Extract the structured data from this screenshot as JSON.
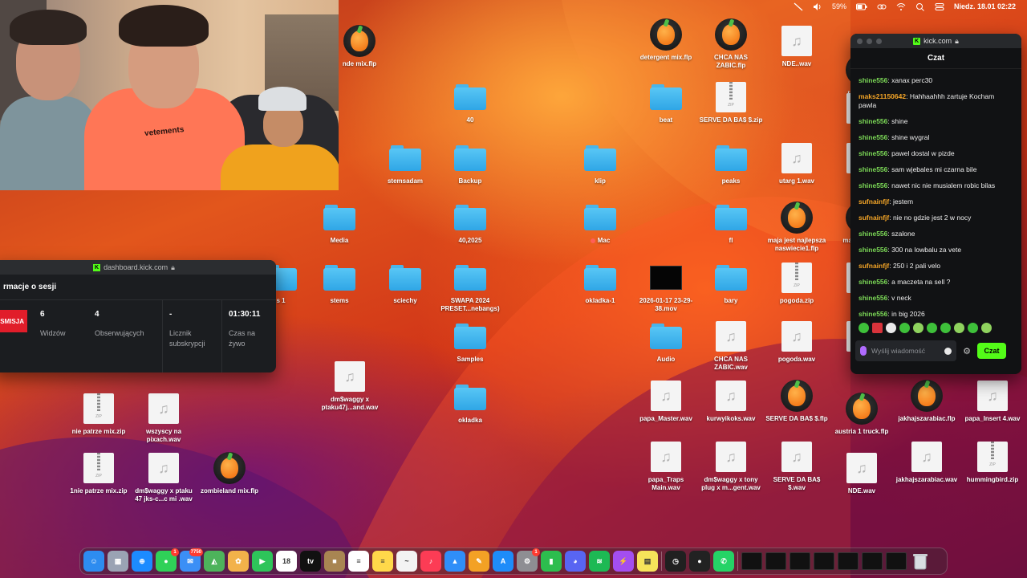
{
  "menubar": {
    "battery": "59%",
    "datetime": "Niedz. 18.01  02:22",
    "icons": [
      "mute-icon",
      "volume-icon",
      "battery-icon",
      "link-icon",
      "wifi-icon",
      "search-icon",
      "control-center-icon"
    ]
  },
  "dashboard": {
    "url": "dashboard.kick.com",
    "heading": "rmacje o sesji",
    "badge": "SMISJA",
    "stats": [
      {
        "value": "6",
        "label": "Widzów"
      },
      {
        "value": "4",
        "label": "Obserwujących"
      },
      {
        "value": "-",
        "label": "Licznik subskrypcji"
      },
      {
        "value": "01:30:11",
        "label": "Czas na żywo"
      }
    ]
  },
  "chat": {
    "url": "kick.com",
    "header": "Czat",
    "placeholder": "Wyślij wiadomość",
    "send_label": "Czat",
    "colors": {
      "green": "#53fc18",
      "user_green": "#7cd957",
      "user_orange": "#f4a527"
    },
    "messages": [
      {
        "user": "shine556",
        "text": "xanax perc30",
        "color": "#7cd957"
      },
      {
        "user": "maks21150642",
        "text": "Hahhaahhh zartuje Kocham pawla",
        "color": "#f4a527"
      },
      {
        "user": "shine556",
        "text": "shine",
        "color": "#7cd957"
      },
      {
        "user": "shine556",
        "text": "shine wygral",
        "color": "#7cd957"
      },
      {
        "user": "shine556",
        "text": "pawel dostal w pizde",
        "color": "#7cd957"
      },
      {
        "user": "shine556",
        "text": "sam wjebales mi czarna bile",
        "color": "#7cd957"
      },
      {
        "user": "shine556",
        "text": "nawet nic nie musialem robic bilas",
        "color": "#7cd957"
      },
      {
        "user": "sufnainfjf",
        "text": "jestem",
        "color": "#f4a527"
      },
      {
        "user": "sufnainfjf",
        "text": "nie no gdzie jest 2 w nocy",
        "color": "#f4a527"
      },
      {
        "user": "shine556",
        "text": "szalone",
        "color": "#7cd957"
      },
      {
        "user": "shine556",
        "text": "300 na lowbalu za vete",
        "color": "#7cd957"
      },
      {
        "user": "sufnainfjf",
        "text": "250 i 2 pali velo",
        "color": "#f4a527"
      },
      {
        "user": "shine556",
        "text": "a maczeta na sell ?",
        "color": "#7cd957"
      },
      {
        "user": "shine556",
        "text": "v neck",
        "color": "#7cd957"
      },
      {
        "user": "shine556",
        "text": "in big 2026",
        "color": "#7cd957"
      }
    ]
  },
  "webcam": {
    "shirt_text": "vetements"
  },
  "desktop_icons": [
    {
      "label": "nde mix.flp",
      "type": "flp"
    },
    {
      "label": "detergent mix.flp",
      "type": "flp"
    },
    {
      "label": "CHCA NAS ZABIC.flp",
      "type": "flp"
    },
    {
      "label": "NDE..wav",
      "type": "wav"
    },
    {
      "label": "rexv type",
      "type": "flp"
    },
    {
      "label": "40",
      "type": "folder"
    },
    {
      "label": "beat",
      "type": "folder"
    },
    {
      "label": "SERVE DA BA$ $.zip",
      "type": "zip"
    },
    {
      "label": "ch",
      "type": "wav"
    },
    {
      "label": "stemsadam",
      "type": "folder"
    },
    {
      "label": "Backup",
      "type": "folder"
    },
    {
      "label": "klip",
      "type": "folder"
    },
    {
      "label": "peaks",
      "type": "folder"
    },
    {
      "label": "utarg 1.wav",
      "type": "wav"
    },
    {
      "label": "Ptasz",
      "type": "wav"
    },
    {
      "label": "Media",
      "type": "folder"
    },
    {
      "label": "40,2025",
      "type": "folder"
    },
    {
      "label": "Mac",
      "type": "folder"
    },
    {
      "label": "fl",
      "type": "folder"
    },
    {
      "label": "maja jest najlepsza naswiecie1.flp",
      "type": "flp"
    },
    {
      "label": "maja j naswi",
      "type": "flp"
    },
    {
      "label": "s 1",
      "type": "folder"
    },
    {
      "label": "stems",
      "type": "folder"
    },
    {
      "label": "sciechy",
      "type": "folder"
    },
    {
      "label": "SWAPA 2024 PRESET...nebangs)",
      "type": "folder"
    },
    {
      "label": "okladka-1",
      "type": "folder"
    },
    {
      "label": "2026-01-17 23-29-38.mov",
      "type": "movie"
    },
    {
      "label": "bary",
      "type": "folder"
    },
    {
      "label": "pogoda.zip",
      "type": "zip"
    },
    {
      "label": "woj",
      "type": "wav"
    },
    {
      "label": "Samples",
      "type": "folder"
    },
    {
      "label": "Audio",
      "type": "folder"
    },
    {
      "label": "CHCA NAS ZABIC.wav",
      "type": "wav"
    },
    {
      "label": "pogoda.wav",
      "type": "wav"
    },
    {
      "label": "u",
      "type": "wav"
    },
    {
      "label": "dm$waggy x ptaku47j...and.wav",
      "type": "wav"
    },
    {
      "label": "okladka",
      "type": "folder"
    },
    {
      "label": "nie patrze mix.zip",
      "type": "zip"
    },
    {
      "label": "wszyscy na pixach.wav",
      "type": "wav"
    },
    {
      "label": "papa_Master.wav",
      "type": "wav"
    },
    {
      "label": "kurwyikoks.wav",
      "type": "wav"
    },
    {
      "label": "SERVE DA BA$ $.flp",
      "type": "flp"
    },
    {
      "label": "austria 1 truck.flp",
      "type": "flp"
    },
    {
      "label": "jakhajszarabiac.flp",
      "type": "flp"
    },
    {
      "label": "papa_Insert 4.wav",
      "type": "wav"
    },
    {
      "label": "1nie patrze mix.zip",
      "type": "zip"
    },
    {
      "label": "dm$waggy x ptaku 47 jks-c...c mi .wav",
      "type": "wav"
    },
    {
      "label": "zombieland mix.flp",
      "type": "flp"
    },
    {
      "label": "papa_Traps Main.wav",
      "type": "wav"
    },
    {
      "label": "dm$waggy x tony plug x m...gent.wav",
      "type": "wav"
    },
    {
      "label": "SERVE DA BA$ $.wav",
      "type": "wav"
    },
    {
      "label": "NDE.wav",
      "type": "wav"
    },
    {
      "label": "jakhajszarabiac.wav",
      "type": "wav"
    },
    {
      "label": "hummingbird.zip",
      "type": "zip"
    }
  ],
  "dock": {
    "apps": [
      {
        "name": "finder",
        "color": "#2d8cf0",
        "glyph": "☺"
      },
      {
        "name": "launchpad",
        "color": "#9aa3b4",
        "glyph": "▦"
      },
      {
        "name": "safari",
        "color": "#1c8bff",
        "glyph": "⊕"
      },
      {
        "name": "messages",
        "color": "#2fd158",
        "glyph": "●",
        "badge": "1"
      },
      {
        "name": "mail",
        "color": "#3b8ff6",
        "glyph": "✉",
        "badge": "7750"
      },
      {
        "name": "maps",
        "color": "#4db35b",
        "glyph": "◭"
      },
      {
        "name": "photos",
        "color": "#f2b24a",
        "glyph": "✿"
      },
      {
        "name": "facetime",
        "color": "#2ec45a",
        "glyph": "▶"
      },
      {
        "name": "calendar",
        "color": "#ffffff",
        "glyph": "18"
      },
      {
        "name": "apple-tv",
        "color": "#111111",
        "glyph": "tv"
      },
      {
        "name": "notes-brown",
        "color": "#a88552",
        "glyph": "■"
      },
      {
        "name": "reminders",
        "color": "#ffffff",
        "glyph": "≡"
      },
      {
        "name": "notes",
        "color": "#ffd84a",
        "glyph": "≡"
      },
      {
        "name": "freeform",
        "color": "#f3f3f3",
        "glyph": "~"
      },
      {
        "name": "music",
        "color": "#fc3c55",
        "glyph": "♪"
      },
      {
        "name": "keynote",
        "color": "#2f8ef8",
        "glyph": "▲"
      },
      {
        "name": "pages",
        "color": "#f3a125",
        "glyph": "✎"
      },
      {
        "name": "app-store",
        "color": "#1e8cf9",
        "glyph": "A"
      },
      {
        "name": "system-settings",
        "color": "#8e8e93",
        "glyph": "⚙",
        "badge": "1"
      },
      {
        "name": "numbers",
        "color": "#2dbd4e",
        "glyph": "▮"
      },
      {
        "name": "discord",
        "color": "#5865f2",
        "glyph": "◕"
      },
      {
        "name": "spotify",
        "color": "#1db954",
        "glyph": "≋"
      },
      {
        "name": "messenger",
        "color": "#a34ef0",
        "glyph": "⚡"
      },
      {
        "name": "stickies",
        "color": "#f6e35a",
        "glyph": "▤"
      },
      {
        "name": "activity",
        "color": "#202020",
        "glyph": "◷"
      },
      {
        "name": "fl-studio",
        "color": "#222222",
        "glyph": "●"
      },
      {
        "name": "whatsapp",
        "color": "#25d366",
        "glyph": "✆"
      }
    ],
    "thumbs": 7
  }
}
